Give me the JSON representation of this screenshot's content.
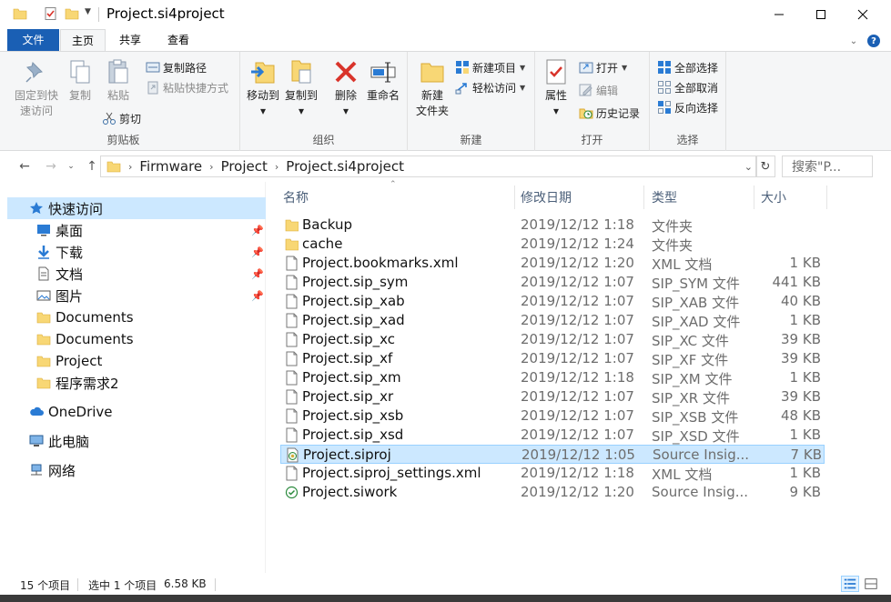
{
  "window": {
    "title": "Project.si4project"
  },
  "ribbon_tabs": {
    "file": "文件",
    "home": "主页",
    "share": "共享",
    "view": "查看"
  },
  "clipboard": {
    "pin_quick_access": "固定到快\n速访问",
    "copy": "复制",
    "paste": "粘贴",
    "copy_path": "复制路径",
    "paste_shortcut": "粘贴快捷方式",
    "cut": "剪切",
    "group_label": "剪贴板"
  },
  "organize": {
    "move_to": "移动到",
    "copy_to": "复制到",
    "delete": "删除",
    "rename": "重命名",
    "group_label": "组织"
  },
  "new": {
    "new_folder": "新建\n文件夹",
    "new_item": "新建项目",
    "easy_access": "轻松访问",
    "group_label": "新建"
  },
  "open": {
    "properties": "属性",
    "open": "打开",
    "edit": "编辑",
    "history": "历史记录",
    "group_label": "打开"
  },
  "select": {
    "select_all": "全部选择",
    "select_none": "全部取消",
    "invert": "反向选择",
    "group_label": "选择"
  },
  "address": {
    "crumbs": [
      "Firmware",
      "Project",
      "Project.si4project"
    ],
    "search_placeholder": "搜索\"P..."
  },
  "nav": {
    "quick_access": "快速访问",
    "desktop": "桌面",
    "downloads": "下载",
    "documents_cn": "文档",
    "pictures": "图片",
    "folder1": "Documents",
    "folder2": "Documents",
    "folder3": "Project",
    "folder4": "程序需求2",
    "onedrive": "OneDrive",
    "this_pc": "此电脑",
    "network": "网络"
  },
  "columns": {
    "name": "名称",
    "date": "修改日期",
    "type": "类型",
    "size": "大小"
  },
  "files": [
    {
      "name": "Backup",
      "date": "2019/12/12 1:18",
      "type": "文件夹",
      "size": "",
      "icon": "folder-icon"
    },
    {
      "name": "cache",
      "date": "2019/12/12 1:24",
      "type": "文件夹",
      "size": "",
      "icon": "folder-icon"
    },
    {
      "name": "Project.bookmarks.xml",
      "date": "2019/12/12 1:20",
      "type": "XML 文档",
      "size": "1 KB",
      "icon": "file-icon"
    },
    {
      "name": "Project.sip_sym",
      "date": "2019/12/12 1:07",
      "type": "SIP_SYM 文件",
      "size": "441 KB",
      "icon": "file-icon"
    },
    {
      "name": "Project.sip_xab",
      "date": "2019/12/12 1:07",
      "type": "SIP_XAB 文件",
      "size": "40 KB",
      "icon": "file-icon"
    },
    {
      "name": "Project.sip_xad",
      "date": "2019/12/12 1:07",
      "type": "SIP_XAD 文件",
      "size": "1 KB",
      "icon": "file-icon"
    },
    {
      "name": "Project.sip_xc",
      "date": "2019/12/12 1:07",
      "type": "SIP_XC 文件",
      "size": "39 KB",
      "icon": "file-icon"
    },
    {
      "name": "Project.sip_xf",
      "date": "2019/12/12 1:07",
      "type": "SIP_XF 文件",
      "size": "39 KB",
      "icon": "file-icon"
    },
    {
      "name": "Project.sip_xm",
      "date": "2019/12/12 1:18",
      "type": "SIP_XM 文件",
      "size": "1 KB",
      "icon": "file-icon"
    },
    {
      "name": "Project.sip_xr",
      "date": "2019/12/12 1:07",
      "type": "SIP_XR 文件",
      "size": "39 KB",
      "icon": "file-icon"
    },
    {
      "name": "Project.sip_xsb",
      "date": "2019/12/12 1:07",
      "type": "SIP_XSB 文件",
      "size": "48 KB",
      "icon": "file-icon"
    },
    {
      "name": "Project.sip_xsd",
      "date": "2019/12/12 1:07",
      "type": "SIP_XSD 文件",
      "size": "1 KB",
      "icon": "file-icon"
    },
    {
      "name": "Project.siproj",
      "date": "2019/12/12 1:05",
      "type": "Source Insig...",
      "size": "7 KB",
      "icon": "siproj-icon",
      "selected": true
    },
    {
      "name": "Project.siproj_settings.xml",
      "date": "2019/12/12 1:18",
      "type": "XML 文档",
      "size": "1 KB",
      "icon": "file-icon"
    },
    {
      "name": "Project.siwork",
      "date": "2019/12/12 1:20",
      "type": "Source Insig...",
      "size": "9 KB",
      "icon": "siwork-icon"
    }
  ],
  "status": {
    "count": "15 个项目",
    "selection": "选中 1 个项目",
    "size": "6.58 KB"
  },
  "colors": {
    "accent": "#1a5fb4",
    "selection": "#cce8ff",
    "folder": "#f8d775"
  }
}
